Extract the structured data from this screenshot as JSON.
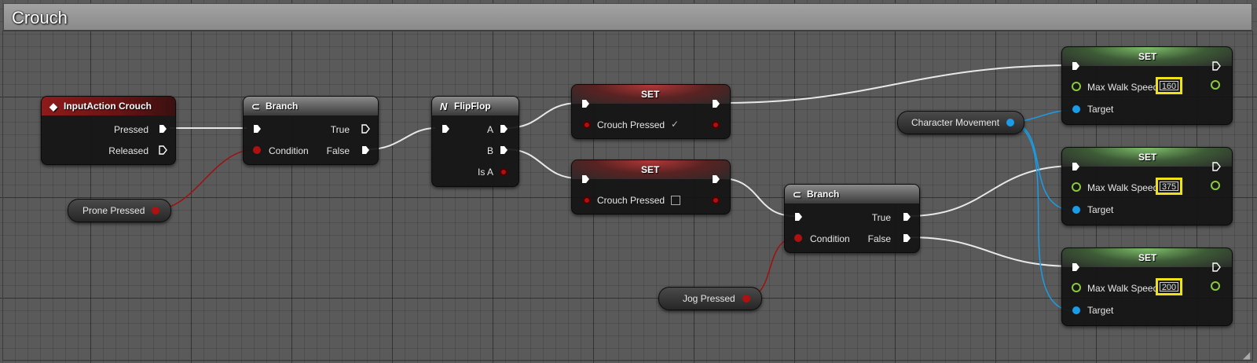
{
  "comment": {
    "title": "Crouch"
  },
  "nodes": {
    "input_action": {
      "title": "InputAction Crouch",
      "pressed": "Pressed",
      "released": "Released"
    },
    "branch1": {
      "title": "Branch",
      "condition": "Condition",
      "true_label": "True",
      "false_label": "False"
    },
    "flipflop": {
      "title": "FlipFlop",
      "a": "A",
      "b": "B",
      "is_a": "Is A"
    },
    "set_crouch_on": {
      "title": "SET",
      "var": "Crouch Pressed",
      "checked": true
    },
    "set_crouch_off": {
      "title": "SET",
      "var": "Crouch Pressed",
      "checked": false
    },
    "branch2": {
      "title": "Branch",
      "condition": "Condition",
      "true_label": "True",
      "false_label": "False"
    },
    "set_speed_1": {
      "title": "SET",
      "var": "Max Walk Speed",
      "value": "160",
      "target": "Target"
    },
    "set_speed_2": {
      "title": "SET",
      "var": "Max Walk Speed",
      "value": "375",
      "target": "Target"
    },
    "set_speed_3": {
      "title": "SET",
      "var": "Max Walk Speed",
      "value": "200",
      "target": "Target"
    }
  },
  "variables": {
    "prone_pressed": "Prone Pressed",
    "jog_pressed": "Jog Pressed",
    "character_movement": "Character Movement"
  },
  "colors": {
    "exec_wire": "#e8e8e8",
    "bool_wire": "#a01010",
    "object_wire": "#1a9ce8",
    "float_pin": "#8ac93a",
    "highlight": "#f0e21a"
  }
}
